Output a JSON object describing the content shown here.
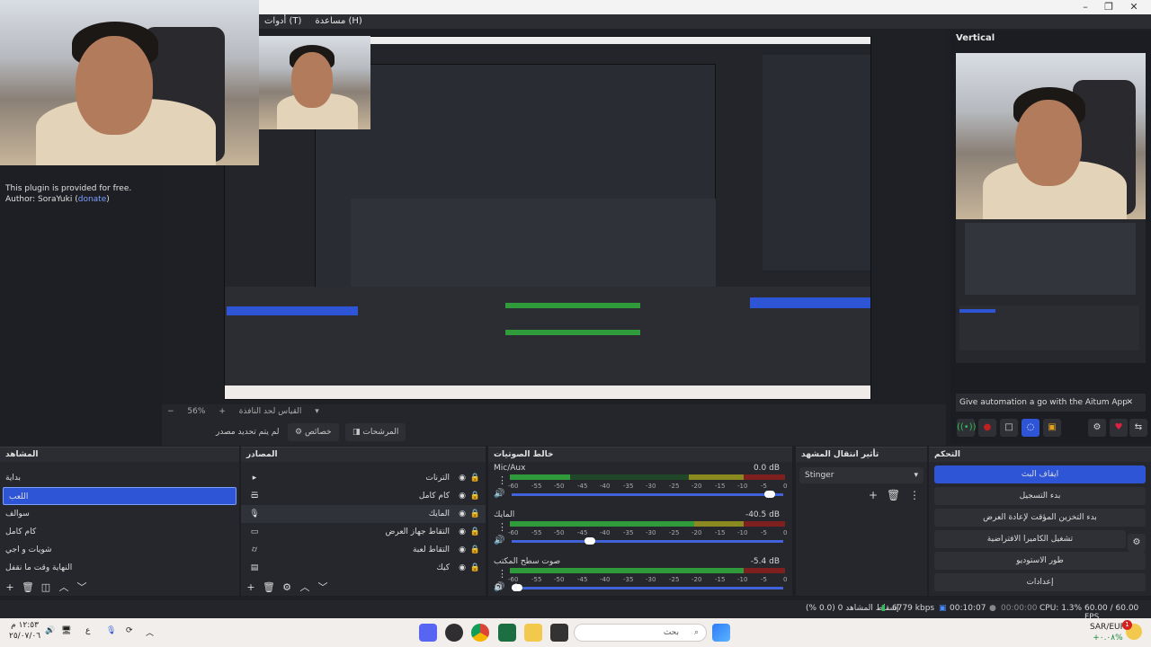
{
  "menubar": {
    "tools": "أدوات (T)",
    "help": "مساعدة (H)"
  },
  "preview": {
    "zoom": "56%",
    "resize_label": "القياس لحد النافذة"
  },
  "left_info": {
    "line1": "This plugin is provided for free.",
    "line2_prefix": "Author: SoraYuki (",
    "donate": "donate",
    "line2_suffix": ")"
  },
  "transition_row": {
    "no_source": "لم يتم تحديد مصدر",
    "properties": "خصائص",
    "filters": "المرشحات"
  },
  "vertical": {
    "title": "Vertical",
    "aitum_banner": "Give automation a go with the Aitum App",
    "close": "✕"
  },
  "scenes": {
    "header": "المشاهد",
    "items": [
      "بداية",
      "اللعب",
      "سوالف",
      "كام كامل",
      "شويات و اجي",
      "النهاية وقت ما نقفل"
    ],
    "selected": 1
  },
  "sources": {
    "header": "المصادر",
    "items": [
      {
        "name": "الترنات",
        "icon": "folder-icon"
      },
      {
        "name": "كام كامل",
        "icon": "list-icon"
      },
      {
        "name": "المايك",
        "icon": "microphone-icon"
      },
      {
        "name": "التقاط جهاز العرض",
        "icon": "monitor-icon"
      },
      {
        "name": "التقاط لعبة",
        "icon": "gamepad-icon"
      },
      {
        "name": "كيك",
        "icon": "browser-icon"
      }
    ]
  },
  "mixer": {
    "header": "خالط الصوتيات",
    "channels": [
      {
        "name": "Mic/Aux",
        "db": "0.0 dB",
        "level": 0.22,
        "fader": 0.97
      },
      {
        "name": "المايك",
        "db": "-40.5 dB",
        "level": 0.67,
        "fader": 0.28
      },
      {
        "name": "صوت سطح المكتب",
        "db": "-5.4 dB",
        "level": 0.85,
        "fader": 0.0
      }
    ],
    "ticks": [
      "-60",
      "-55",
      "-50",
      "-45",
      "-40",
      "-35",
      "-30",
      "-25",
      "-20",
      "-15",
      "-10",
      "-5",
      "0"
    ]
  },
  "transitions": {
    "header": "تأثير انتقال المشهد",
    "selected": "Stinger"
  },
  "controls": {
    "header": "التحكم",
    "buttons": [
      "ايقاف البث",
      "بدء التسجيل",
      "بدء التخزين المؤقت لإعادة العرض",
      "تشغيل الكاميرا الافتراضية",
      "طور الاستوديو",
      "إعدادات"
    ]
  },
  "statusbar": {
    "dropped": "إسقاط المشاهد 0 (0.0 %)",
    "kbps": "6779 kbps",
    "stream_time": "00:10:07",
    "rec_time": "00:00:00",
    "cpu": "CPU: 1.3%",
    "fps": "60.00 / 60.00 FPS"
  },
  "taskbar": {
    "time": "١٢:٥٣ م",
    "date": "٢٥/٠٧/٠٦",
    "lang": "ع",
    "search_placeholder": "بحث",
    "currency": "SAR/EUR",
    "currency_change": "+٠.٠٨%",
    "notif_count": "1"
  },
  "colors": {
    "accent": "#2e55d6",
    "meter_green": "#2f9b3a",
    "meter_yellow": "#8a8a20",
    "meter_red": "#7e2020",
    "panel": "#25272d"
  }
}
